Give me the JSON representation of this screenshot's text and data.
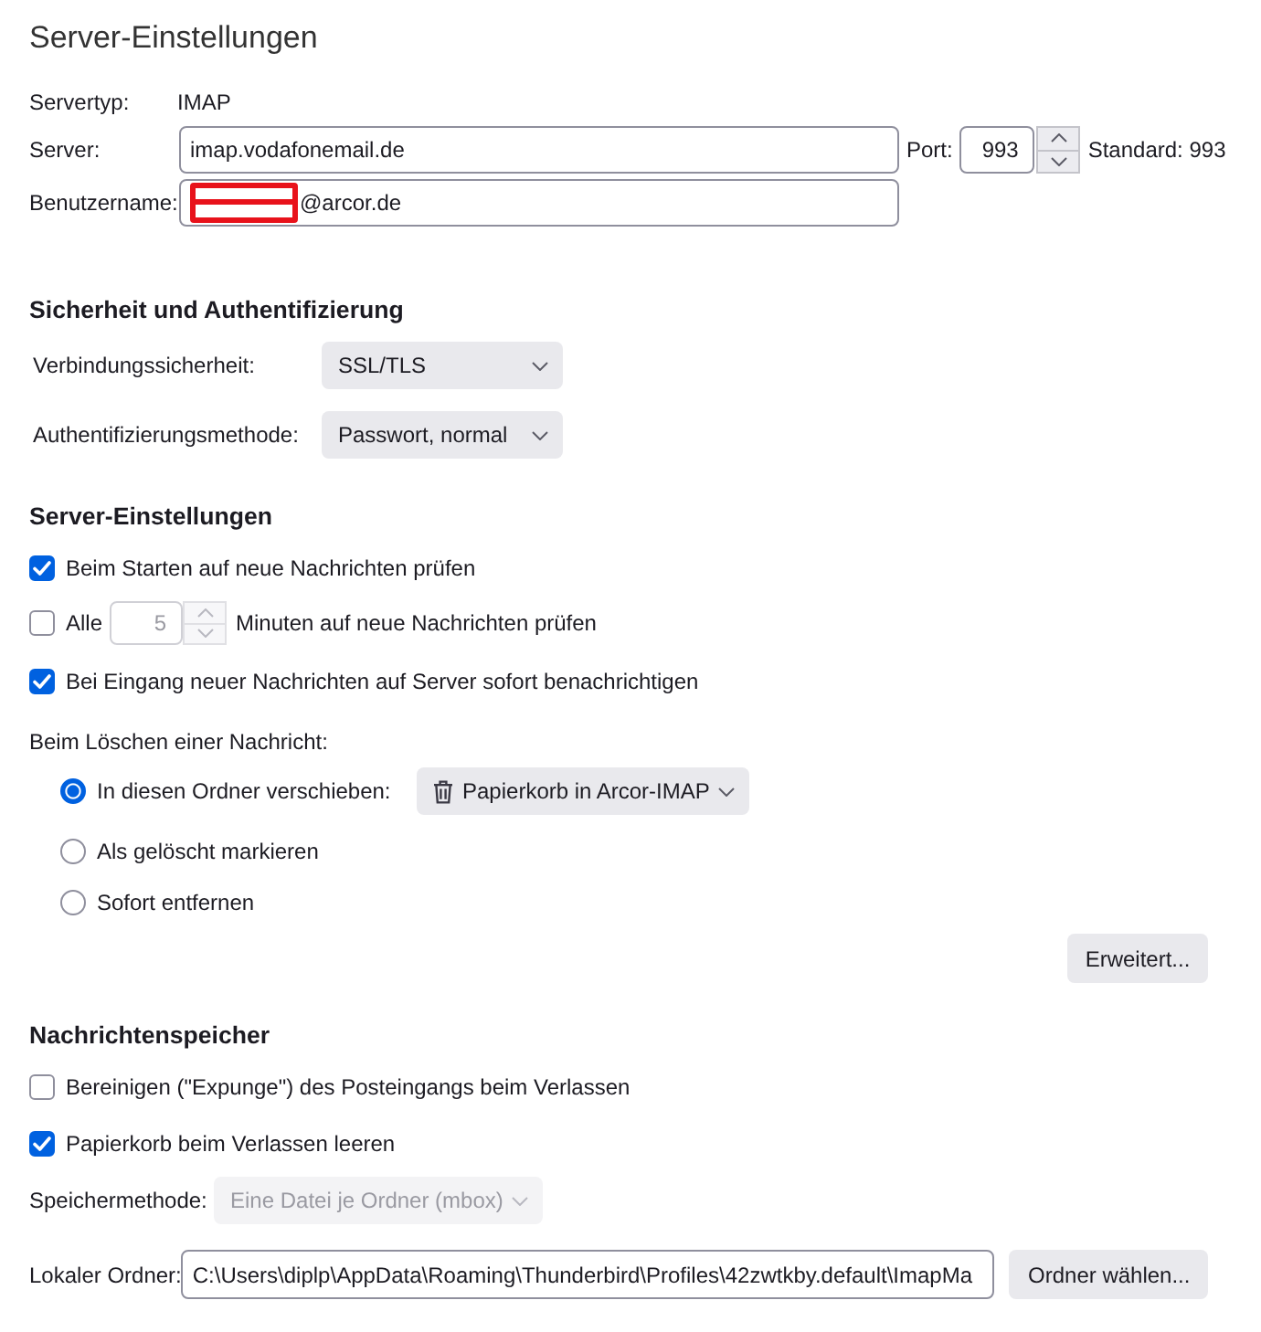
{
  "page_title": "Server-Einstellungen",
  "server_info": {
    "server_type": {
      "label": "Servertyp:",
      "value": "IMAP"
    },
    "server": {
      "label": "Server:",
      "value": "imap.vodafonemail.de"
    },
    "port": {
      "label": "Port:",
      "value": "993",
      "default_text": "Standard: 993"
    },
    "username": {
      "label": "Benutzername:",
      "value": "@arcor.de",
      "redacted": true
    }
  },
  "security": {
    "heading": "Sicherheit und Authentifizierung",
    "fields": [
      {
        "label": "Verbindungssicherheit:",
        "value": "SSL/TLS"
      },
      {
        "label": "Authentifizierungsmethode:",
        "value": "Passwort, normal"
      }
    ]
  },
  "server_settings": {
    "heading": "Server-Einstellungen",
    "options": [
      {
        "kind": "checkbox",
        "label": "Beim Starten auf neue Nachrichten prüfen",
        "checked": true
      },
      {
        "kind": "interval",
        "label": "Alle",
        "checked": false,
        "value": "5",
        "disabled": true,
        "suffix": "Minuten auf neue Nachrichten prüfen"
      },
      {
        "kind": "checkbox",
        "label": "Bei Eingang neuer Nachrichten auf Server sofort benachrichtigen",
        "checked": true
      }
    ],
    "delete_label": "Beim Löschen einer Nachricht:",
    "delete_options": [
      {
        "label": "In diesen Ordner verschieben:",
        "selected": true,
        "folder": "Papierkorb in Arcor-IMAP"
      },
      {
        "label": "Als gelöscht markieren",
        "selected": false
      },
      {
        "label": "Sofort entfernen",
        "selected": false
      }
    ],
    "advanced_button": {
      "label": "Erweitert..."
    }
  },
  "message_storage": {
    "heading": "Nachrichtenspeicher",
    "options": [
      {
        "label": "Bereinigen (\"Expunge\") des Posteingangs beim Verlassen",
        "checked": false
      },
      {
        "label": "Papierkorb beim Verlassen leeren",
        "checked": true
      }
    ],
    "store_type": {
      "label": "Speichermethode:",
      "value": "Eine Datei je Ordner (mbox)",
      "disabled": true
    },
    "local_folder": {
      "label": "Lokaler Ordner:",
      "value": "C:\\Users\\diplp\\AppData\\Roaming\\Thunderbird\\Profiles\\42zwtkby.default\\ImapMa",
      "button": {
        "label": "Ordner wählen..."
      }
    }
  }
}
